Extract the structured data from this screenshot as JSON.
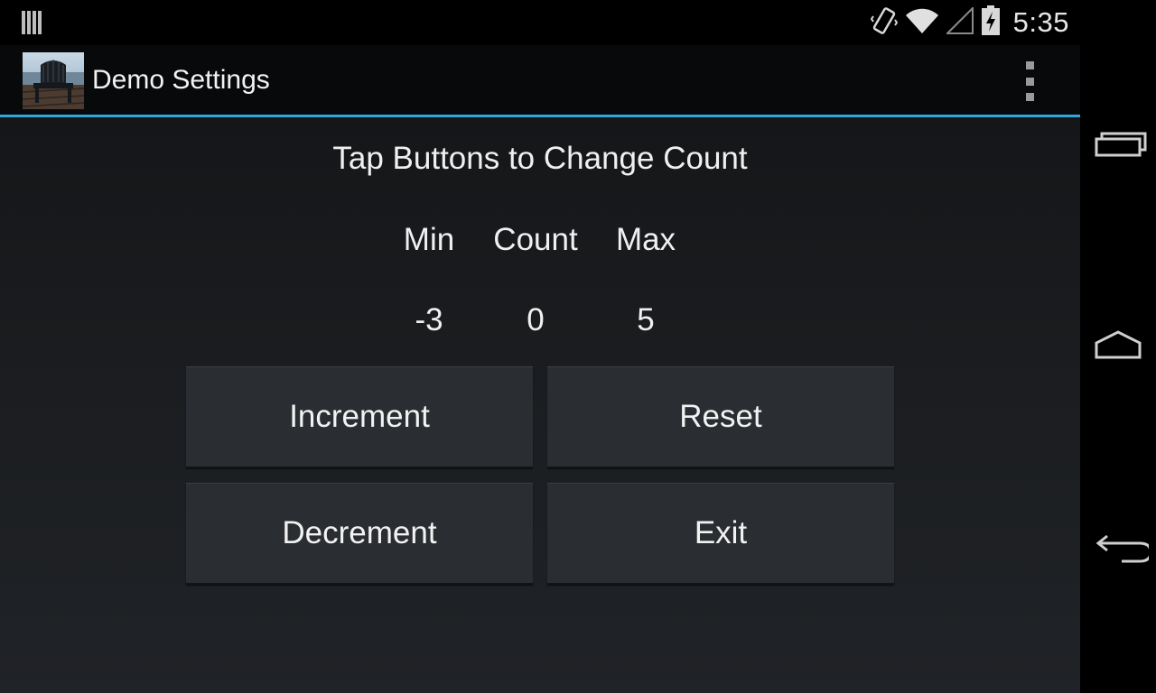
{
  "status_bar": {
    "time": "5:35",
    "icons": [
      "notification-bars-icon",
      "vibrate-icon",
      "wifi-icon",
      "signal-icon",
      "battery-charging-icon"
    ]
  },
  "action_bar": {
    "title": "Demo Settings",
    "app_icon": "chair-photo-icon",
    "menu_icon": "overflow-menu-icon",
    "accent_color": "#33a6d9"
  },
  "content": {
    "heading": "Tap Buttons to Change Count",
    "labels": {
      "min": "Min",
      "count": "Count",
      "max": "Max"
    },
    "values": {
      "min": "-3",
      "count": "0",
      "max": "5"
    }
  },
  "buttons": {
    "increment": "Increment",
    "reset": "Reset",
    "decrement": "Decrement",
    "exit": "Exit"
  },
  "nav_bar": {
    "icons": [
      "recent-apps-icon",
      "home-icon",
      "back-icon"
    ]
  }
}
